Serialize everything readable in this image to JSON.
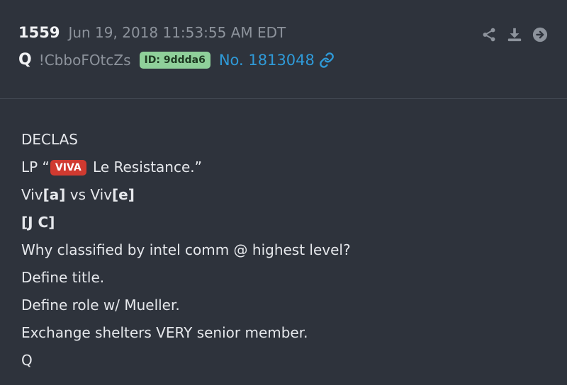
{
  "post": {
    "number": "1559",
    "timestamp": "Jun 19, 2018 11:53:55 AM EDT",
    "author": "Q",
    "tripcode": "!CbboFOtcZs",
    "id_badge": "ID: 9ddda6",
    "post_link": "No. 1813048"
  },
  "actions": {
    "icons": [
      "share-icon",
      "download-icon",
      "forward-arrow-icon"
    ]
  },
  "body": {
    "line1": "DECLAS",
    "line2_prefix": "LP “",
    "line2_badge": "VIVA",
    "line2_suffix": " Le Resistance.”",
    "line3_a": "Viv",
    "line3_b": "[a]",
    "line3_c": " vs Viv",
    "line3_d": "[e]",
    "line4": "[J C]",
    "line5": "Why classified by intel comm @ highest level?",
    "line6": "Define title.",
    "line7": "Define role w/ Mueller.",
    "line8": "Exchange shelters VERY senior member.",
    "line9": "Q"
  },
  "colors": {
    "background": "#2e333c",
    "link": "#2f9ad8",
    "id_badge_bg": "#8fd09a",
    "viva_badge_bg": "#d03a30",
    "muted_text": "#8d939c"
  }
}
